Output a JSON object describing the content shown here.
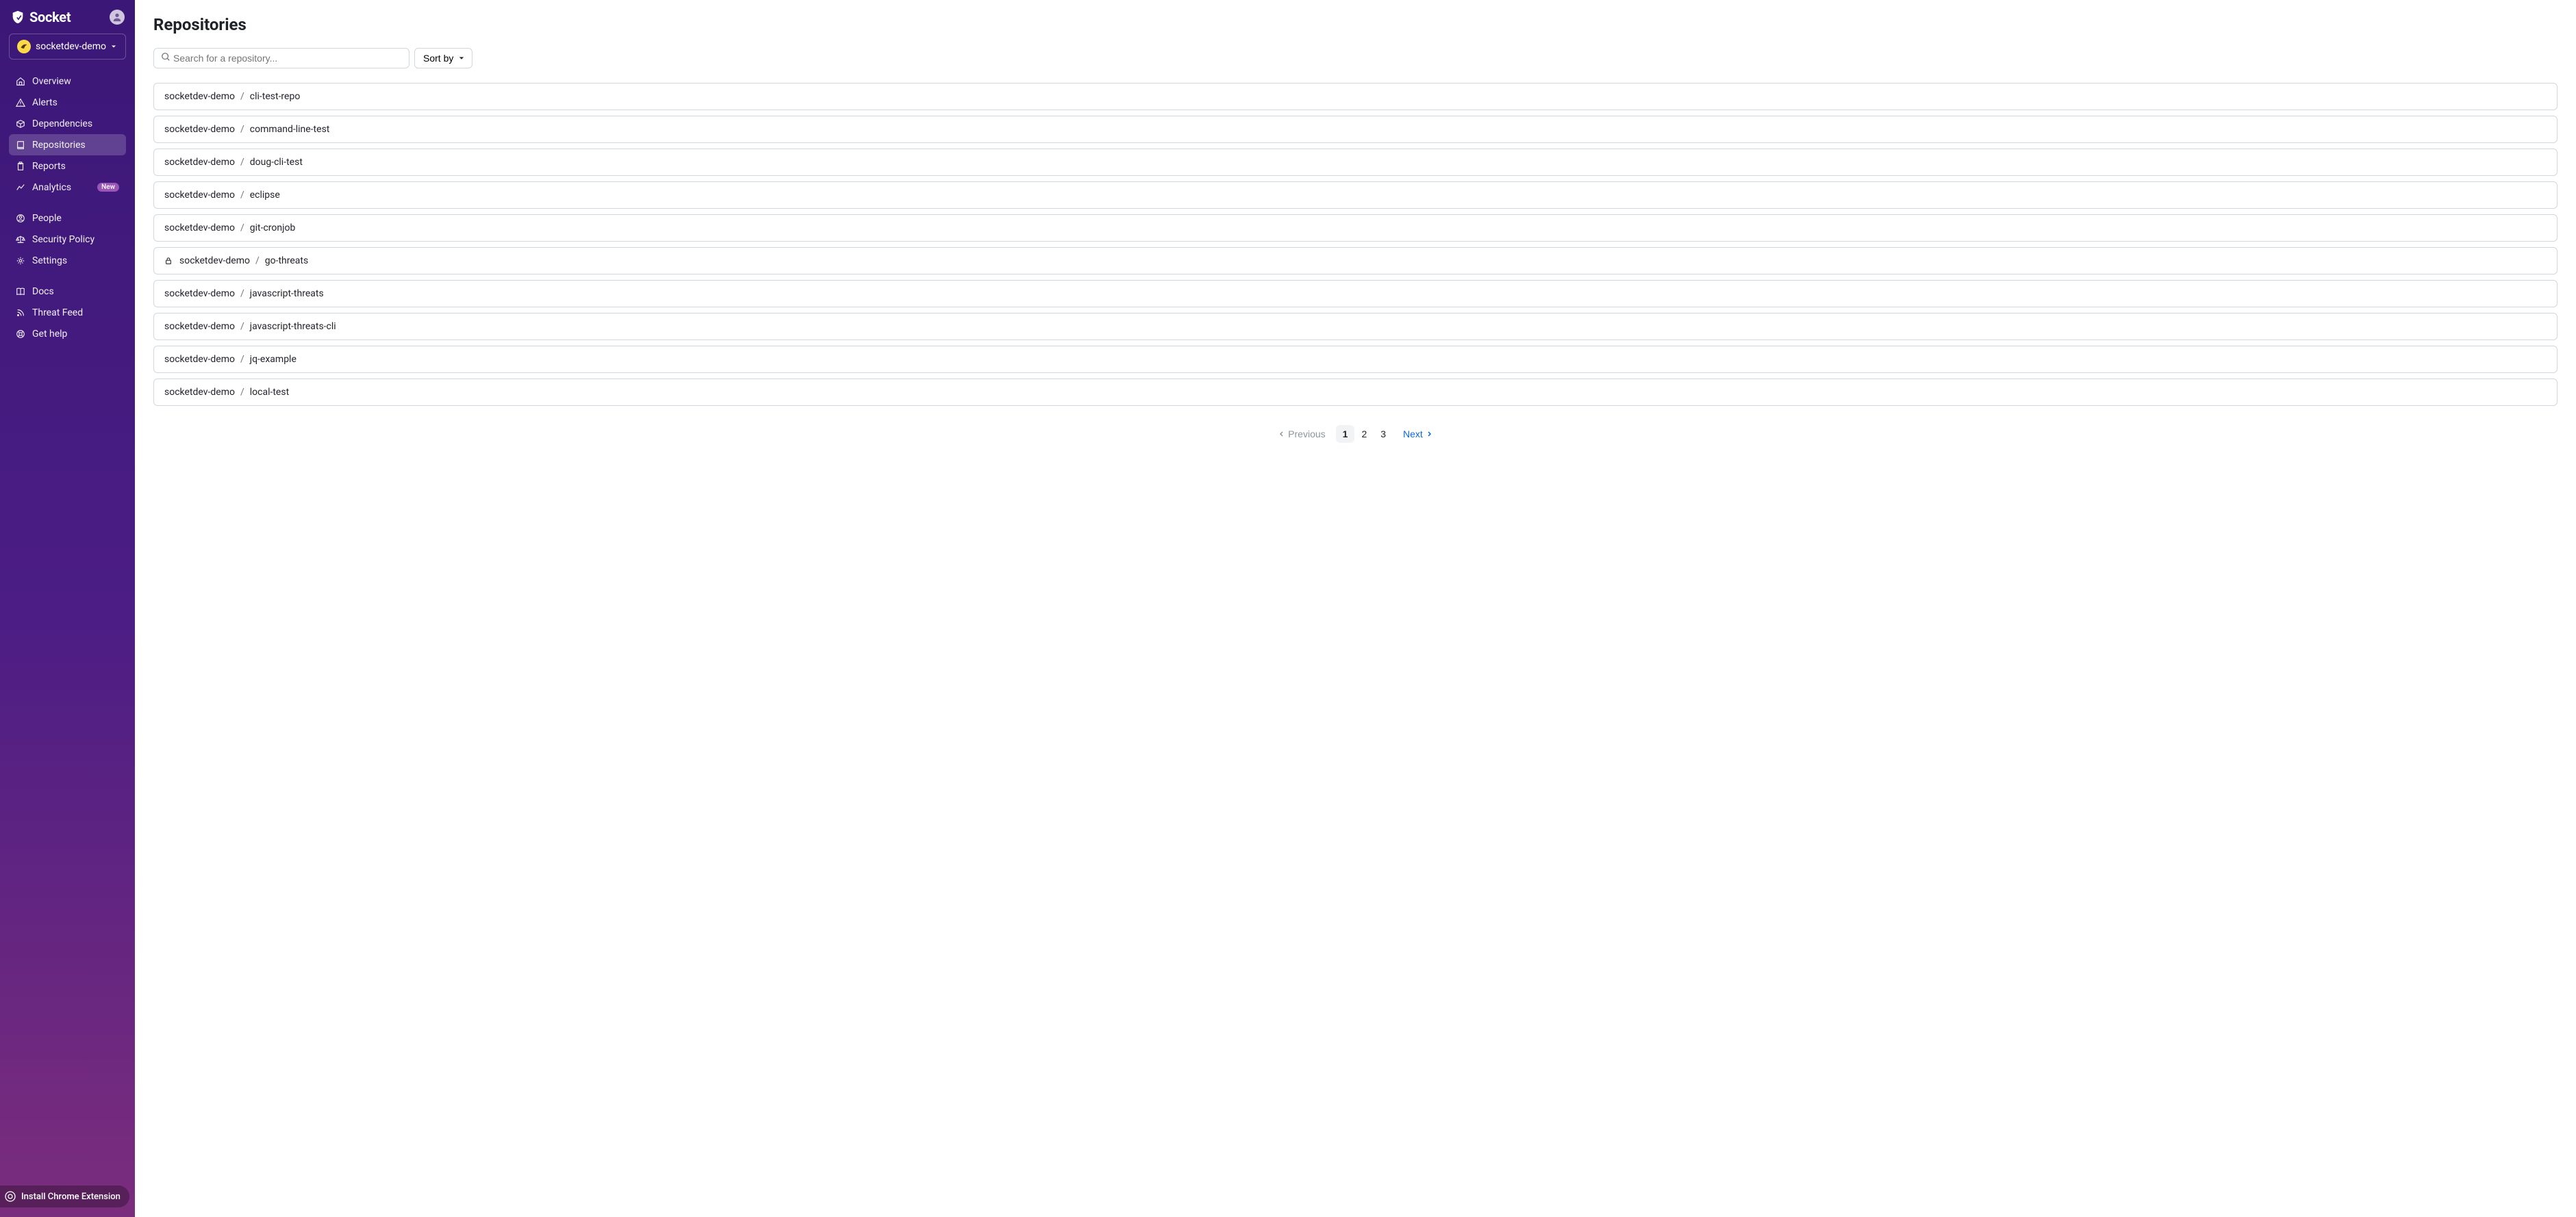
{
  "brand": "Socket",
  "org": {
    "name": "socketdev-demo"
  },
  "sidebar": {
    "items": [
      {
        "label": "Overview"
      },
      {
        "label": "Alerts"
      },
      {
        "label": "Dependencies"
      },
      {
        "label": "Repositories"
      },
      {
        "label": "Reports"
      },
      {
        "label": "Analytics",
        "badge": "New"
      },
      {
        "label": "People"
      },
      {
        "label": "Security Policy"
      },
      {
        "label": "Settings"
      },
      {
        "label": "Docs"
      },
      {
        "label": "Threat Feed"
      },
      {
        "label": "Get help"
      }
    ]
  },
  "chrome_ext": "Install Chrome Extension",
  "page": {
    "title": "Repositories"
  },
  "search": {
    "placeholder": "Search for a repository..."
  },
  "sort": {
    "label": "Sort by"
  },
  "repos": [
    {
      "owner": "socketdev-demo",
      "name": "cli-test-repo",
      "locked": false
    },
    {
      "owner": "socketdev-demo",
      "name": "command-line-test",
      "locked": false
    },
    {
      "owner": "socketdev-demo",
      "name": "doug-cli-test",
      "locked": false
    },
    {
      "owner": "socketdev-demo",
      "name": "eclipse",
      "locked": false
    },
    {
      "owner": "socketdev-demo",
      "name": "git-cronjob",
      "locked": false
    },
    {
      "owner": "socketdev-demo",
      "name": "go-threats",
      "locked": true
    },
    {
      "owner": "socketdev-demo",
      "name": "javascript-threats",
      "locked": false
    },
    {
      "owner": "socketdev-demo",
      "name": "javascript-threats-cli",
      "locked": false
    },
    {
      "owner": "socketdev-demo",
      "name": "jq-example",
      "locked": false
    },
    {
      "owner": "socketdev-demo",
      "name": "local-test",
      "locked": false
    }
  ],
  "pagination": {
    "prev": "Previous",
    "next": "Next",
    "pages": [
      "1",
      "2",
      "3"
    ],
    "current": 0
  }
}
